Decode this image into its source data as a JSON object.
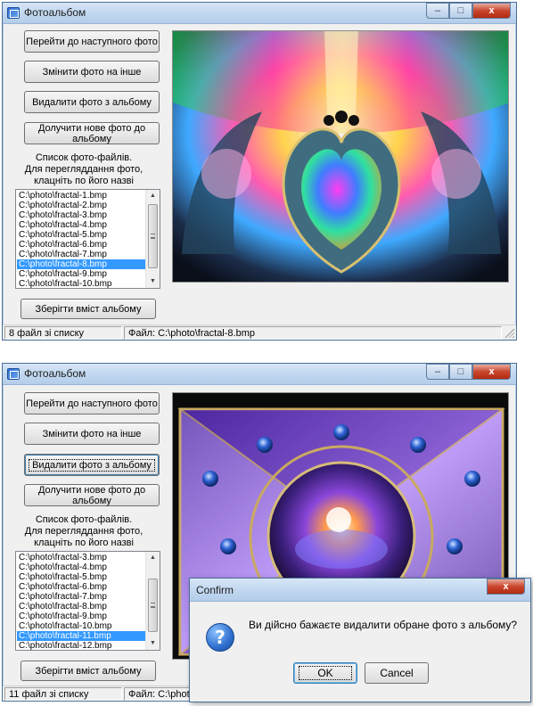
{
  "window1": {
    "title": "Фотоальбом",
    "buttons": {
      "next": "Перейти до наступного фото",
      "change": "Змінити фото на інше",
      "delete": "Видалити фото з альбому",
      "add": "Долучити нове фото до альбому",
      "save": "Зберігти  вміст  альбому"
    },
    "caption": "Список фото-файлів.\nДля перегляддання фото,\nклацніть по його назві",
    "list": [
      "C:\\photo\\fractal-1.bmp",
      "C:\\photo\\fractal-2.bmp",
      "C:\\photo\\fractal-3.bmp",
      "C:\\photo\\fractal-4.bmp",
      "C:\\photo\\fractal-5.bmp",
      "C:\\photo\\fractal-6.bmp",
      "C:\\photo\\fractal-7.bmp",
      "C:\\photo\\fractal-8.bmp",
      "C:\\photo\\fractal-9.bmp",
      "C:\\photo\\fractal-10.bmp"
    ],
    "selected_item": "C:\\photo\\fractal-8.bmp",
    "status_left": "8  файл зі списку",
    "status_right": "Файл: C:\\photo\\fractal-8.bmp"
  },
  "window2": {
    "title": "Фотоальбом",
    "buttons": {
      "next": "Перейти до наступного фото",
      "change": "Змінити фото на інше",
      "delete": "Видалити фото з альбому",
      "add": "Долучити нове фото до альбому",
      "save": "Зберігти  вміст  альбому"
    },
    "caption": "Список фото-файлів.\nДля перегляддання фото,\nклацніть по його назві",
    "list": [
      "C:\\photo\\fractal-3.bmp",
      "C:\\photo\\fractal-4.bmp",
      "C:\\photo\\fractal-5.bmp",
      "C:\\photo\\fractal-6.bmp",
      "C:\\photo\\fractal-7.bmp",
      "C:\\photo\\fractal-8.bmp",
      "C:\\photo\\fractal-9.bmp",
      "C:\\photo\\fractal-10.bmp",
      "C:\\photo\\fractal-11.bmp",
      "C:\\photo\\fractal-12.bmp"
    ],
    "selected_item": "C:\\photo\\fractal-11.bmp",
    "status_left": "11  файл зі списку",
    "status_right": "Файл: C:\\photo\\"
  },
  "confirm": {
    "title": "Confirm",
    "message": "Ви дійсно бажаєте видалити обране фото з альбому?",
    "ok": "OK",
    "cancel": "Cancel"
  },
  "controls": {
    "minimize": "–",
    "maximize": "□",
    "close": "x"
  },
  "icons": [
    "app-icon",
    "info-icon",
    "scroll-up-icon",
    "scroll-down-icon"
  ],
  "colors": {
    "selection": "#3399ff",
    "titlebar": "#c2d8f0",
    "close": "#c9462d"
  }
}
